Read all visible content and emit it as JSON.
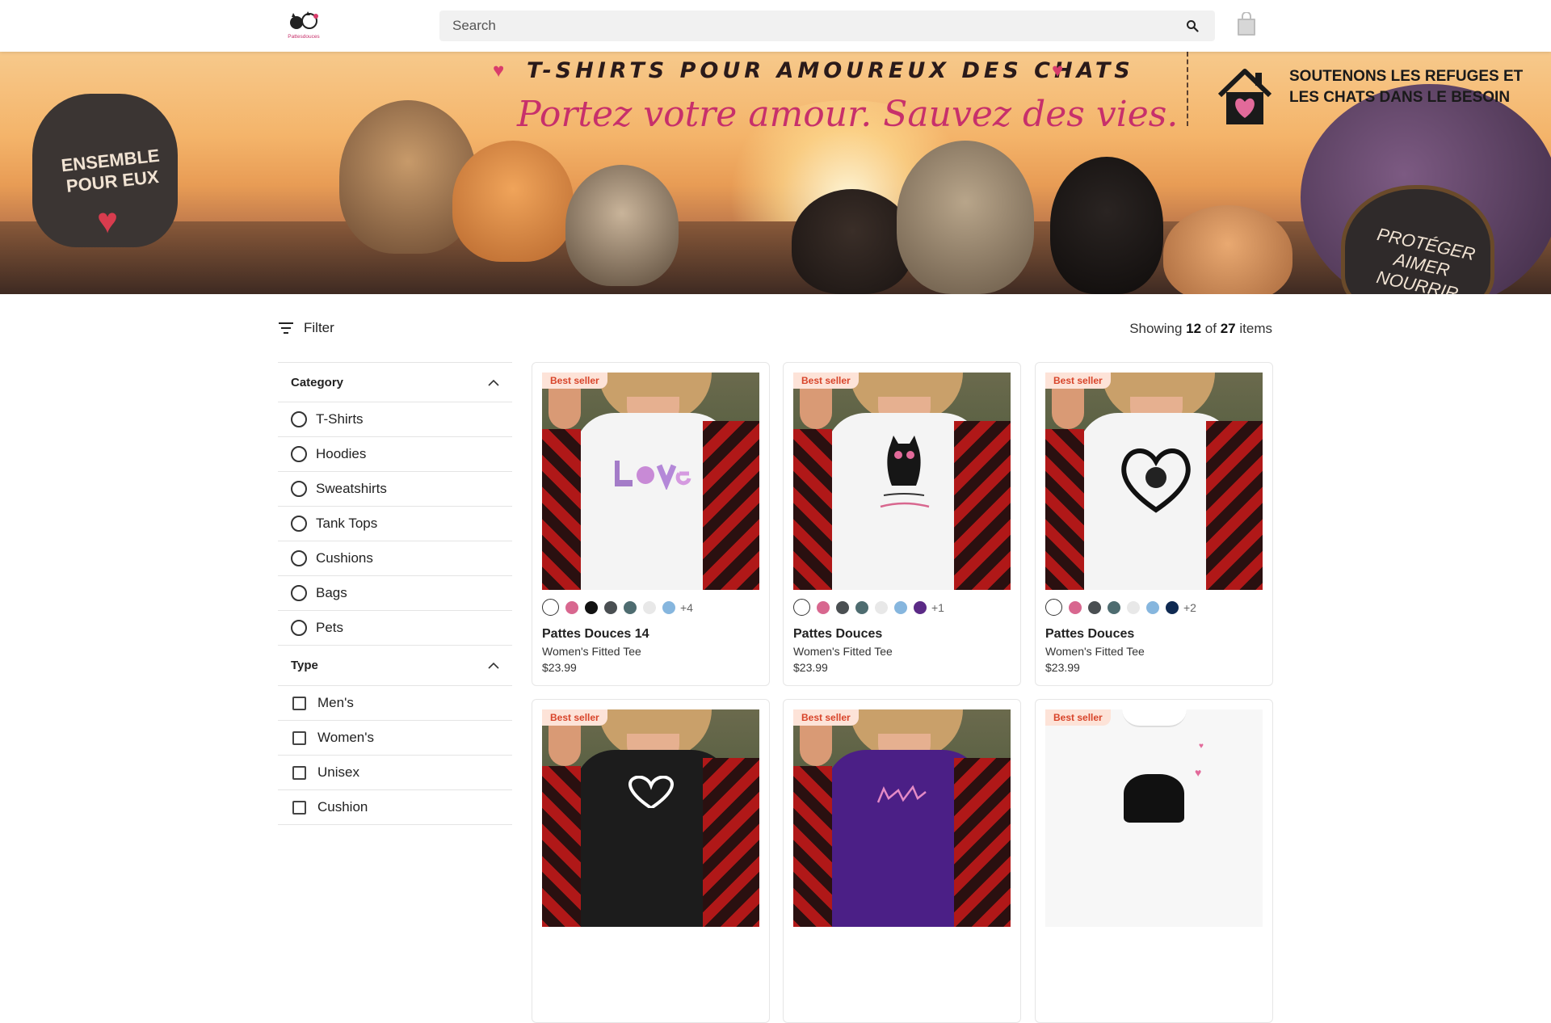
{
  "header": {
    "logo_text": "Pattesdouces",
    "search_placeholder": "Search"
  },
  "banner": {
    "title": "T-SHIRTS POUR AMOUREUX DES CHATS",
    "subtitle": "Portez votre amour. Sauvez des vies.",
    "right_text": "SOUTENONS LES REFUGES ET LES CHATS DANS LE BESOIN",
    "left_badge": "ENSEMBLE POUR EUX",
    "right_badge": "PROTÉGER AIMER NOURRIR"
  },
  "toolbar": {
    "filter_label": "Filter",
    "showing_prefix": "Showing",
    "shown": "12",
    "of_label": "of",
    "total": "27",
    "items_label": "items"
  },
  "sidebar": {
    "category_title": "Category",
    "categories": [
      "T-Shirts",
      "Hoodies",
      "Sweatshirts",
      "Tank Tops",
      "Cushions",
      "Bags",
      "Pets"
    ],
    "type_title": "Type",
    "types": [
      "Men's",
      "Women's",
      "Unisex",
      "Cushion"
    ]
  },
  "products": [
    {
      "badge": "Best seller",
      "name": "Pattes Douces 14",
      "type": "Women's Fitted Tee",
      "price": "$23.99",
      "more": "+4",
      "shirt_color": "#f4f4f4",
      "swatches": [
        "#ffffff",
        "#d8678f",
        "#111111",
        "#4a4f52",
        "#4e6c70",
        "#e8e8e8",
        "#86b6de"
      ]
    },
    {
      "badge": "Best seller",
      "name": "Pattes Douces",
      "type": "Women's Fitted Tee",
      "price": "$23.99",
      "more": "+1",
      "shirt_color": "#f4f4f4",
      "swatches": [
        "#ffffff",
        "#d8678f",
        "#4a4f52",
        "#4e6c70",
        "#e8e8e8",
        "#86b6de",
        "#5b2a86"
      ]
    },
    {
      "badge": "Best seller",
      "name": "Pattes Douces",
      "type": "Women's Fitted Tee",
      "price": "$23.99",
      "more": "+2",
      "shirt_color": "#f4f4f4",
      "swatches": [
        "#ffffff",
        "#d8678f",
        "#4a4f52",
        "#4e6c70",
        "#e8e8e8",
        "#86b6de",
        "#0f2a52"
      ]
    },
    {
      "badge": "Best seller",
      "shirt_color": "#1c1c1c"
    },
    {
      "badge": "Best seller",
      "shirt_color": "#4b1f86"
    },
    {
      "badge": "Best seller",
      "shirt_color": "#f7f7f7"
    }
  ]
}
